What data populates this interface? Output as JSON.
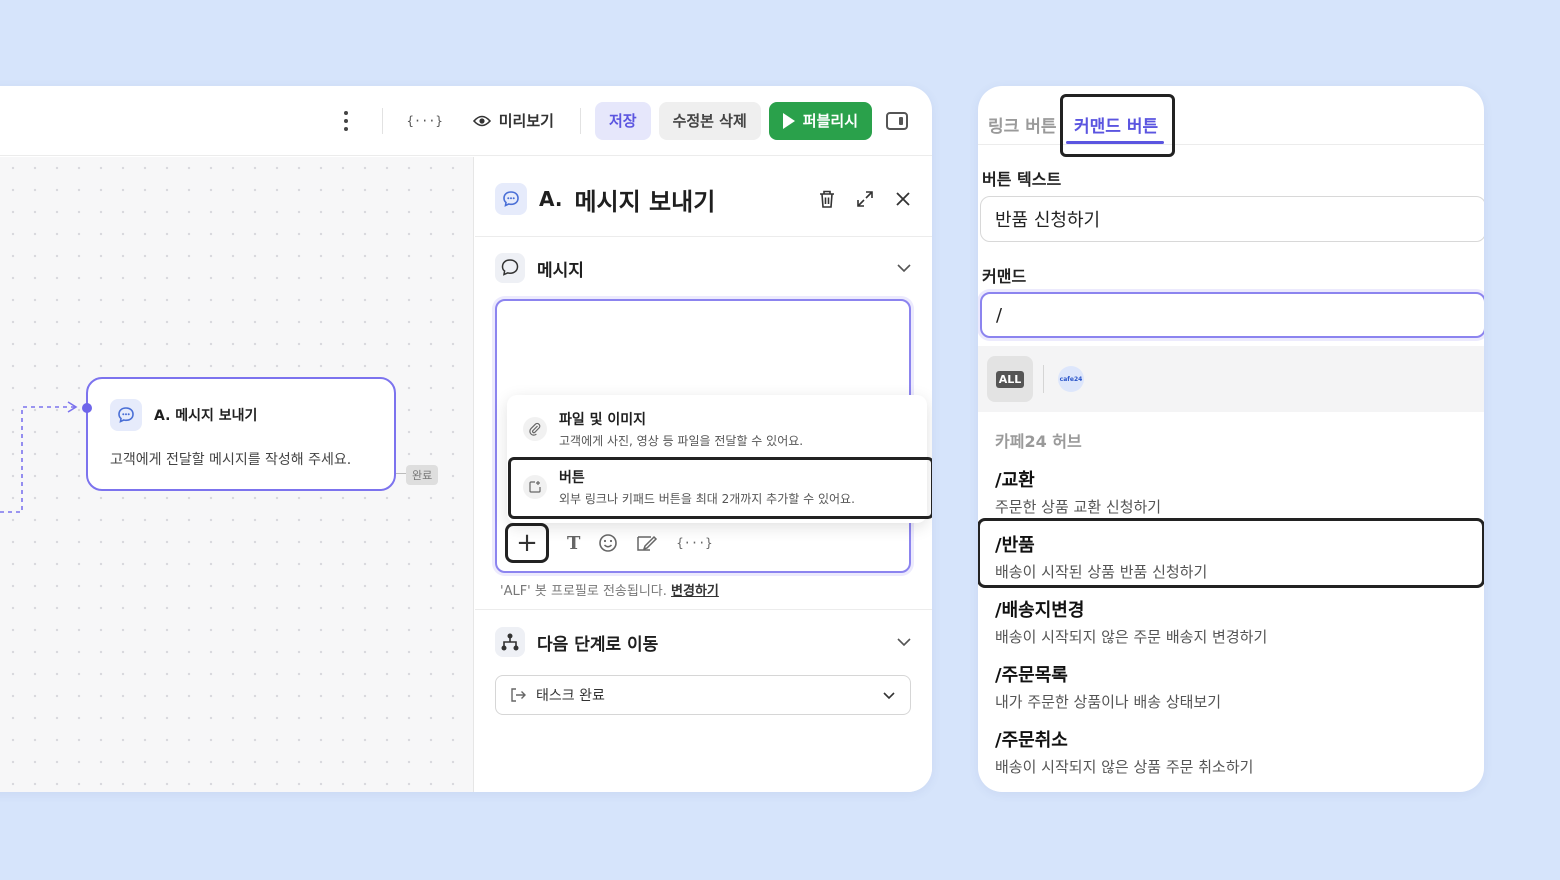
{
  "toolbar": {
    "variable_label": "{···}",
    "preview_label": "미리보기",
    "save_label": "저장",
    "delete_revision_label": "수정본 삭제",
    "publish_label": "퍼블리시"
  },
  "node": {
    "title": "A. 메시지 보내기",
    "description": "고객에게 전달할 메시지를 작성해 주세요.",
    "badge": "완료"
  },
  "side_panel": {
    "step_label": "A.",
    "title": "메시지 보내기",
    "message_section": "메시지",
    "attach_menu": [
      {
        "title": "파일 및 이미지",
        "description": "고객에게 사진, 영상 등 파일을 전달할 수 있어요."
      },
      {
        "title": "버튼",
        "description": "외부 링크나 키패드 버튼을 최대 2개까지 추가할 수 있어요."
      }
    ],
    "sender_note": "'ALF' 봇 프로필로 전송됩니다.",
    "change_link": "변경하기",
    "next_step_section": "다음 단계로 이동",
    "next_step_value": "태스크 완료"
  },
  "command_panel": {
    "tabs": [
      "링크 버튼",
      "커맨드 버튼"
    ],
    "active_tab": "커맨드 버튼",
    "button_text_label": "버튼 텍스트",
    "button_text_value": "반품 신청하기",
    "command_label": "커맨드",
    "command_value": "/",
    "filter_all": "ALL",
    "filter_cafe24": "cafe24",
    "group_label": "카페24 허브",
    "commands": [
      {
        "name": "/교환",
        "description": "주문한 상품 교환 신청하기"
      },
      {
        "name": "/반품",
        "description": "배송이 시작된 상품 반품 신청하기"
      },
      {
        "name": "/배송지변경",
        "description": "배송이 시작되지 않은 주문 배송지 변경하기"
      },
      {
        "name": "/주문목록",
        "description": "내가 주문한 상품이나 배송 상태보기"
      },
      {
        "name": "/주문취소",
        "description": "배송이 시작되지 않은 상품 주문 취소하기"
      }
    ]
  },
  "colors": {
    "background": "#d6e4fb",
    "accent": "#5b55e0",
    "publish": "#2aa14b",
    "node_border": "#7c73ee"
  }
}
